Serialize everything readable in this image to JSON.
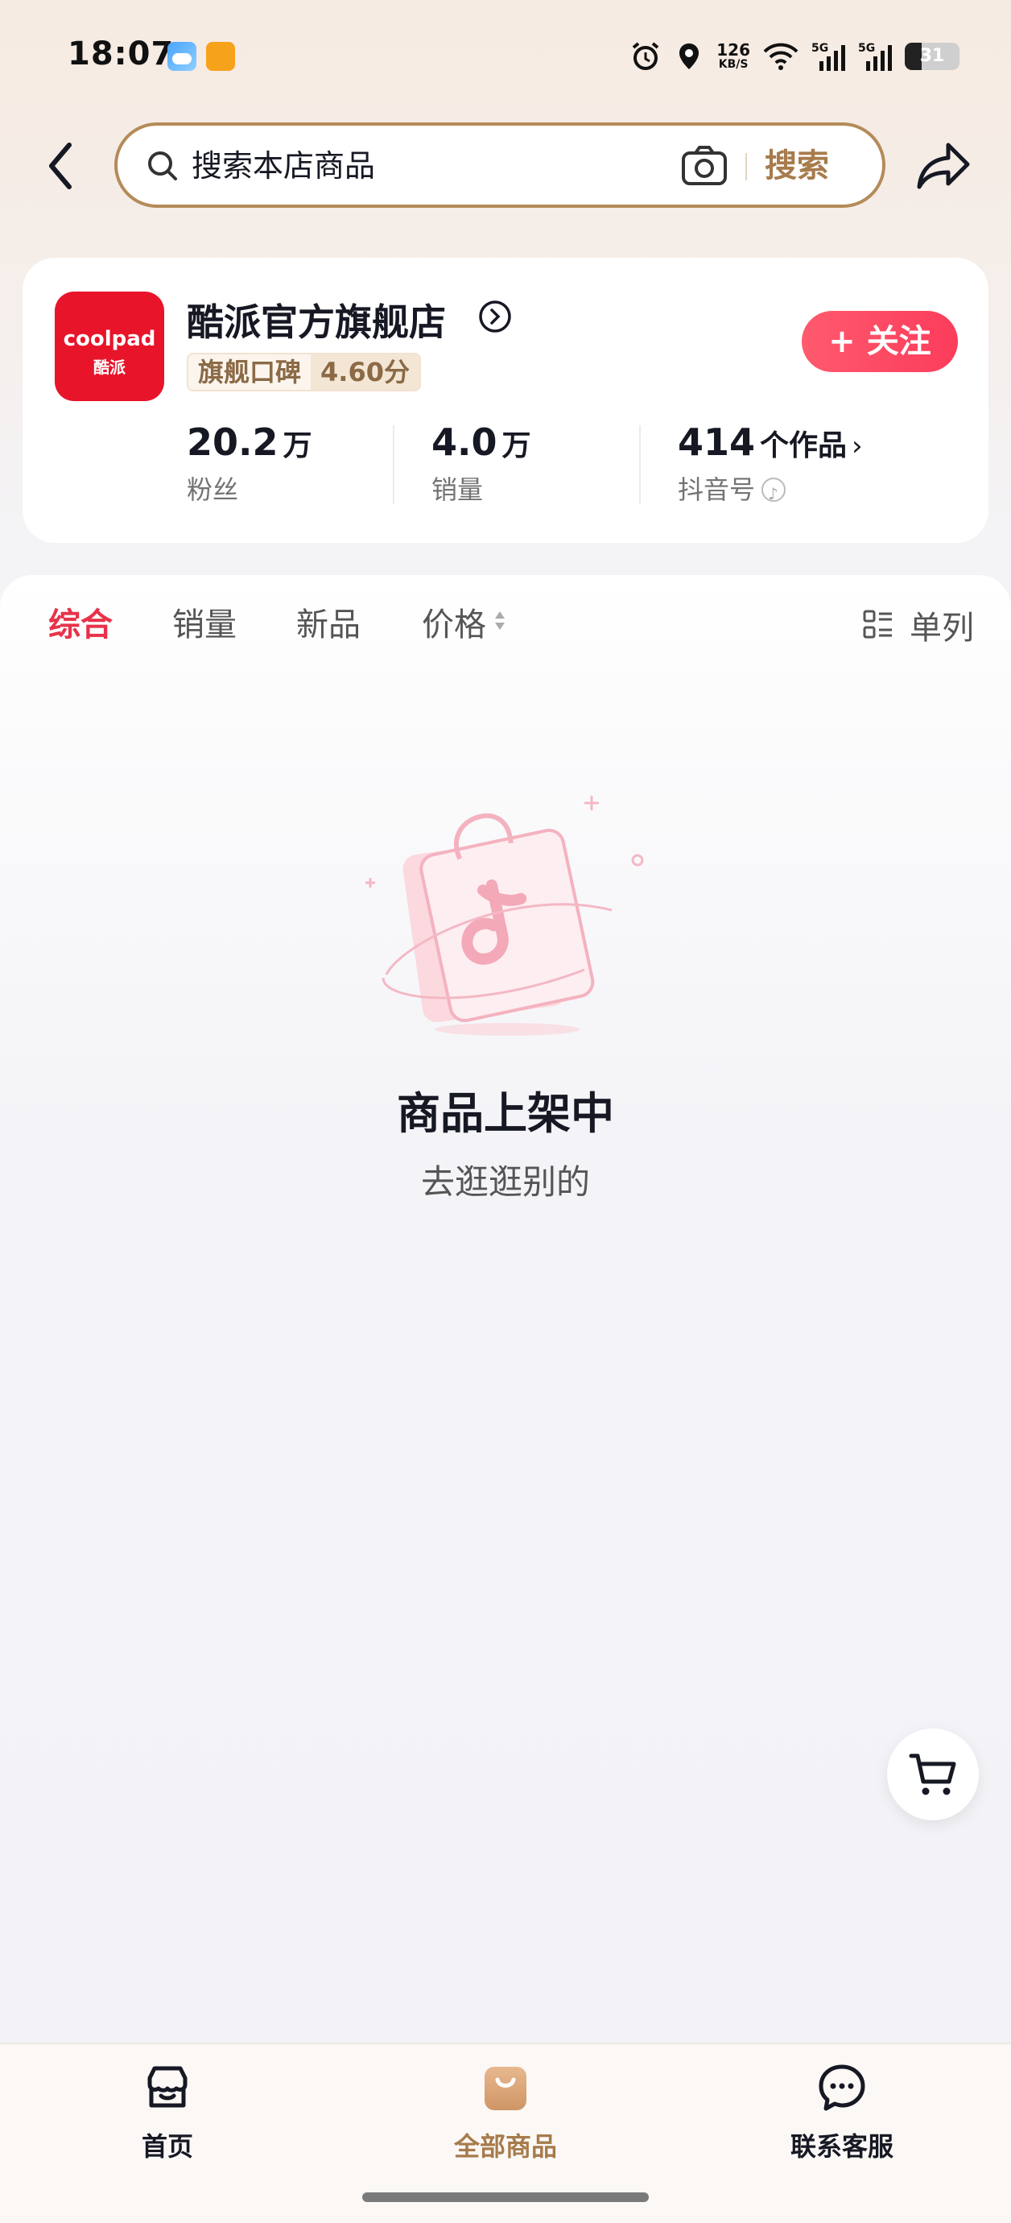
{
  "status_bar": {
    "time": "18:07",
    "net_speed_value": "126",
    "net_speed_unit": "KB/S",
    "battery": "31",
    "icons": [
      "alarm-icon",
      "location-icon",
      "wifi-icon",
      "signal-5g-icon",
      "signal-5g-icon",
      "battery-icon"
    ]
  },
  "header": {
    "search_placeholder": "搜索本店商品",
    "search_button": "搜索"
  },
  "store": {
    "logo_text": "coolpad",
    "logo_subtext": "酷派",
    "name": "酷派官方旗舰店",
    "badge_label": "旗舰口碑",
    "badge_score": "4.60分",
    "follow_label": "+ 关注",
    "stats": [
      {
        "value": "20.2",
        "unit": "万",
        "label": "粉丝"
      },
      {
        "value": "4.0",
        "unit": "万",
        "label": "销量"
      },
      {
        "value": "414",
        "unit": "个作品",
        "label": "抖音号"
      }
    ]
  },
  "tabs": {
    "items": [
      "综合",
      "销量",
      "新品",
      "价格"
    ],
    "active": "综合",
    "layout_toggle": "单列"
  },
  "empty_state": {
    "title": "商品上架中",
    "subtitle": "去逛逛别的"
  },
  "bottom_nav": {
    "items": [
      {
        "label": "首页",
        "icon": "store-icon"
      },
      {
        "label": "全部商品",
        "icon": "shopping-bag-icon"
      },
      {
        "label": "联系客服",
        "icon": "chat-icon"
      }
    ],
    "active": "全部商品"
  },
  "colors": {
    "accent": "#e8324a",
    "brand_gold": "#a77b4c",
    "store_logo": "#e8142a"
  }
}
